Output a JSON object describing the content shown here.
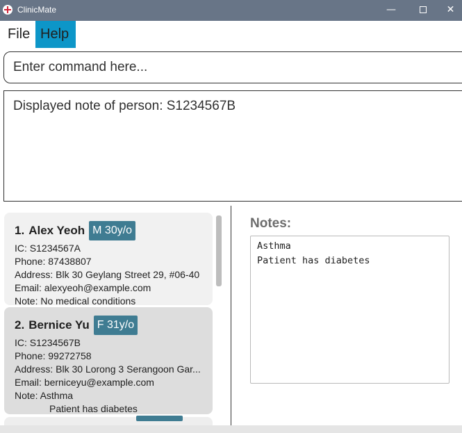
{
  "window": {
    "title": "ClinicMate",
    "min_glyph": "—",
    "close_glyph": "✕"
  },
  "menu": {
    "file": "File",
    "help": "Help"
  },
  "command": {
    "placeholder": "Enter command here..."
  },
  "result": {
    "text": "Displayed note of person: S1234567B"
  },
  "persons": [
    {
      "index": "1.",
      "name": "Alex Yeoh",
      "badge": "M 30y/o",
      "ic": "IC: S1234567A",
      "phone": "Phone: 87438807",
      "address": "Address: Blk 30 Geylang Street 29, #06-40",
      "email": "Email: alexyeoh@example.com",
      "note": "Note: No medical conditions"
    },
    {
      "index": "2.",
      "name": "Bernice Yu",
      "badge": "F 31y/o",
      "ic": "IC: S1234567B",
      "phone": "Phone: 99272758",
      "address": "Address: Blk 30 Lorong 3 Serangoon Gar...",
      "email": "Email: berniceyu@example.com",
      "note": "Note: Asthma",
      "note_cont": "Patient has diabetes"
    }
  ],
  "notes": {
    "label": "Notes:",
    "lines": [
      "Asthma",
      "Patient has diabetes"
    ]
  },
  "colors": {
    "titlebar": "#687587",
    "menu_highlight": "#0d96c8",
    "badge": "#3f7c92",
    "card_selected": "#dddddd"
  }
}
